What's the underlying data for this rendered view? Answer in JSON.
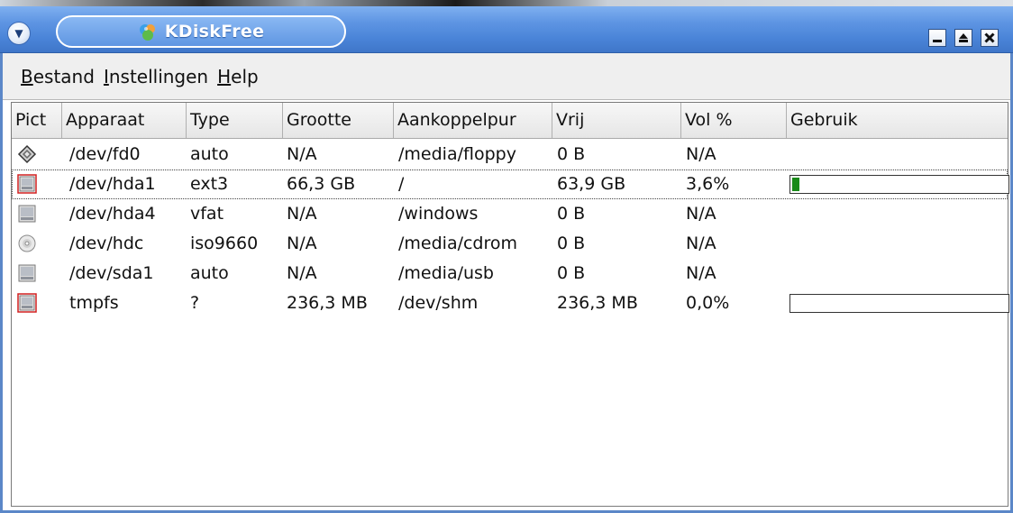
{
  "window": {
    "title": "KDiskFree"
  },
  "menu": [
    {
      "mnemonic": "B",
      "rest": "estand"
    },
    {
      "mnemonic": "I",
      "rest": "nstellingen"
    },
    {
      "mnemonic": "H",
      "rest": "elp"
    }
  ],
  "columns": [
    "Pict",
    "Apparaat",
    "Type",
    "Grootte",
    "Aankoppelpur",
    "Vrij",
    "Vol %",
    "Gebruik"
  ],
  "rows": [
    {
      "icon": "floppy-icon",
      "device": "/dev/fd0",
      "type": "auto",
      "size": "N/A",
      "mount": "/media/floppy",
      "free": "0 B",
      "percent": "N/A",
      "usage": null
    },
    {
      "icon": "harddisk-mounted-icon",
      "device": "/dev/hda1",
      "type": "ext3",
      "size": "66,3 GB",
      "mount": "/",
      "free": "63,9 GB",
      "percent": "3,6%",
      "usage": 0.036
    },
    {
      "icon": "harddisk-icon",
      "device": "/dev/hda4",
      "type": "vfat",
      "size": "N/A",
      "mount": "/windows",
      "free": "0 B",
      "percent": "N/A",
      "usage": null
    },
    {
      "icon": "cdrom-icon",
      "device": "/dev/hdc",
      "type": "iso9660",
      "size": "N/A",
      "mount": "/media/cdrom",
      "free": "0 B",
      "percent": "N/A",
      "usage": null
    },
    {
      "icon": "harddisk-icon",
      "device": "/dev/sda1",
      "type": "auto",
      "size": "N/A",
      "mount": "/media/usb",
      "free": "0 B",
      "percent": "N/A",
      "usage": null
    },
    {
      "icon": "harddisk-mounted-icon",
      "device": "tmpfs",
      "type": "?",
      "size": "236,3 MB",
      "mount": "/dev/shm",
      "free": "236,3 MB",
      "percent": "0,0%",
      "usage": 0.0
    }
  ],
  "colors": {
    "titlebar": "#5e95e3",
    "usage_fill": "#1a8a1a",
    "mounted_outline": "#d22020"
  }
}
